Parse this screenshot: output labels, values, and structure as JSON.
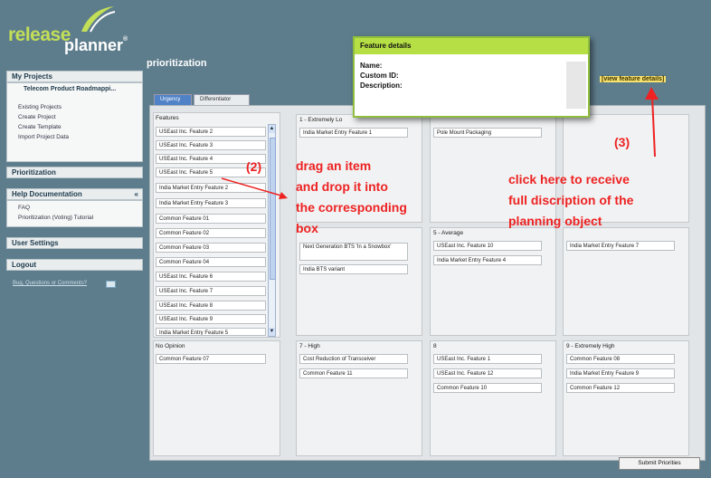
{
  "brand": {
    "part1": "release",
    "part2": "planner",
    "mark": "®"
  },
  "page_title": "prioritization",
  "tabs": [
    {
      "label": "Urgency"
    },
    {
      "label": "Differentiator"
    }
  ],
  "sidebar": {
    "my_projects": "My Projects",
    "project_name": "Telecom Product Roadmappi...",
    "project_links": [
      "Existing Projects",
      "Create Project",
      "Create Template",
      "Import Project Data"
    ],
    "prioritization": "Prioritization",
    "help": "Help Documentation",
    "help_toggle": "«",
    "help_links": [
      "FAQ",
      "Prioritization (Voting) Tutorial"
    ],
    "user_settings": "User Settings",
    "logout": "Logout",
    "bug_link": "Bug, Questions or Comments?"
  },
  "features_panel": {
    "label": "Features",
    "items": [
      "USEast Inc. Feature 2",
      "USEast Inc. Feature 3",
      "USEast Inc. Feature 4",
      "USEast Inc. Feature 5",
      "India Market Entry Feature 2",
      "India Market Entry Feature 3",
      "Common Feature 01",
      "Common Feature 02",
      "Common Feature 03",
      "Common Feature 04",
      "USEast Inc. Feature 6",
      "USEast Inc. Feature 7",
      "USEast Inc. Feature 8",
      "USEast Inc. Feature 9",
      "India Market Entry Feature 5"
    ]
  },
  "no_opinion": {
    "label": "No Opinion",
    "items": [
      "Common Feature 07"
    ]
  },
  "buckets": {
    "b1": {
      "label": "1 - Extremely Lo",
      "items": [
        "India Market Entry Feature 1"
      ]
    },
    "b2": {
      "items": [
        "Pole Mount Packaging"
      ]
    },
    "b4": {
      "items": [
        "Next Generation BTS 'In a Snowbox'",
        "India BTS variant"
      ]
    },
    "b5": {
      "label": "5 - Average",
      "items": [
        "USEast Inc. Feature 10",
        "India Market Entry Feature 4"
      ]
    },
    "b6": {
      "items": [
        "India Market Entry Feature 7"
      ]
    },
    "b7": {
      "label": "7 - High",
      "items": [
        "Cost Reduction of Transceiver",
        "Common Feature 11"
      ]
    },
    "b8": {
      "label": "8",
      "items": [
        "USEast Inc. Feature 1",
        "USEast Inc. Feature 12",
        "Common Feature 10"
      ]
    },
    "b9": {
      "label": "9 - Extremely High",
      "items": [
        "Common Feature 08",
        "India Market Entry Feature 9",
        "Common Feature 12"
      ]
    }
  },
  "view_details_link": "[view feature details]",
  "popup": {
    "title": "Feature details",
    "name_line": "Name: ",
    "custom_line": "Custom ID: ",
    "description_line": "Description:"
  },
  "submit_label": "Submit Priorities",
  "annotations": {
    "step2": "(2)",
    "drag_text": [
      "drag an item",
      "and drop it into",
      "the corresponding",
      "box"
    ],
    "step3": "(3)",
    "click_text": [
      "click here to receive",
      "full discription of the",
      "planning object"
    ]
  },
  "colors": {
    "header_bg": "#5e7d8c",
    "brand_green": "#c3df57",
    "annotation_red": "#ee2222",
    "popup_head": "#b5df44"
  }
}
